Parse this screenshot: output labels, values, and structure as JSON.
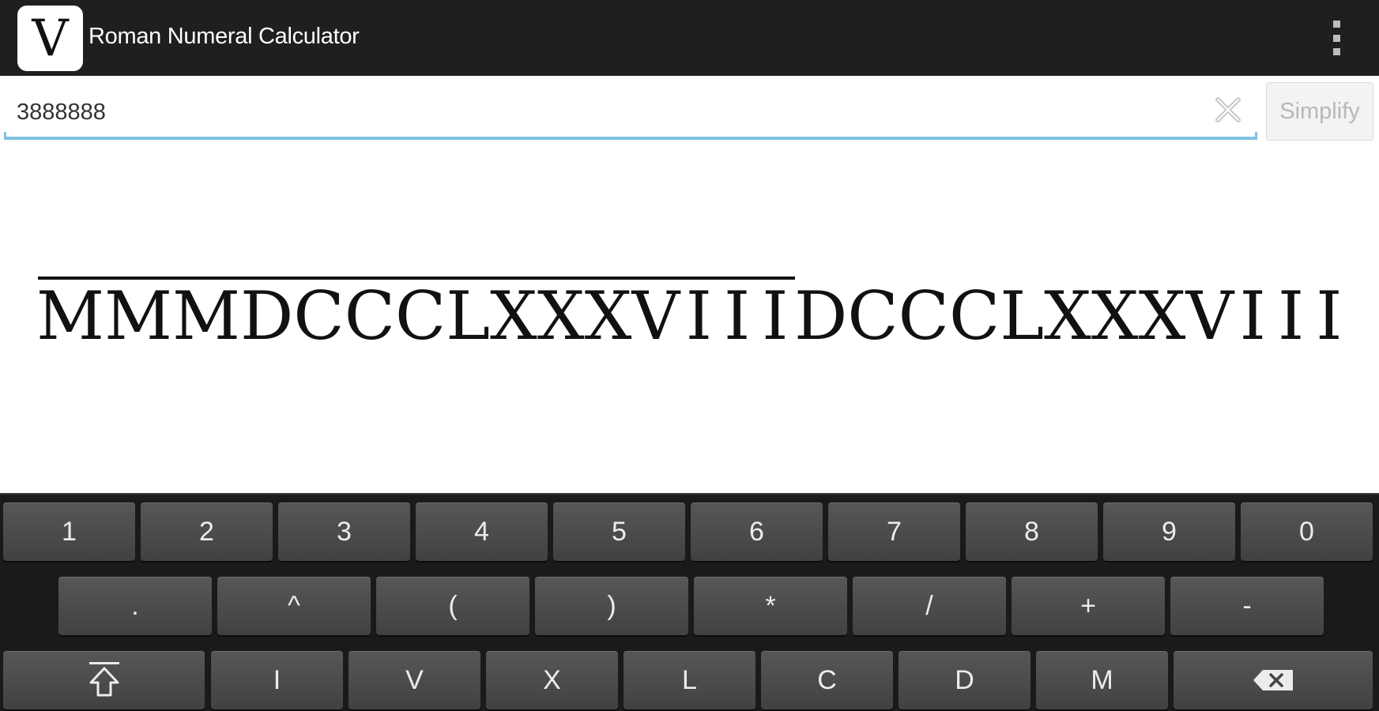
{
  "app": {
    "icon_letter": "V",
    "title": "Roman Numeral Calculator"
  },
  "input": {
    "value": "3888888"
  },
  "simplify_label": "Simplify",
  "result": {
    "vinculum_part": [
      "M",
      "M",
      "M",
      "D",
      "C",
      "C",
      "C",
      "L",
      "X",
      "X",
      "X",
      "V",
      "I",
      "I",
      "I"
    ],
    "plain_part": [
      "D",
      "C",
      "C",
      "C",
      "L",
      "X",
      "X",
      "X",
      "V",
      "I",
      "I",
      "I"
    ]
  },
  "keyboard": {
    "row1": [
      "1",
      "2",
      "3",
      "4",
      "5",
      "6",
      "7",
      "8",
      "9",
      "0"
    ],
    "row2": [
      ".",
      "^",
      "(",
      ")",
      "*",
      "/",
      "+",
      "-"
    ],
    "row3": [
      "I",
      "V",
      "X",
      "L",
      "C",
      "D",
      "M"
    ]
  },
  "icons": {
    "clear": "clear-icon",
    "overflow": "overflow-menu-icon",
    "shift": "shift-icon",
    "backspace": "backspace-icon"
  }
}
